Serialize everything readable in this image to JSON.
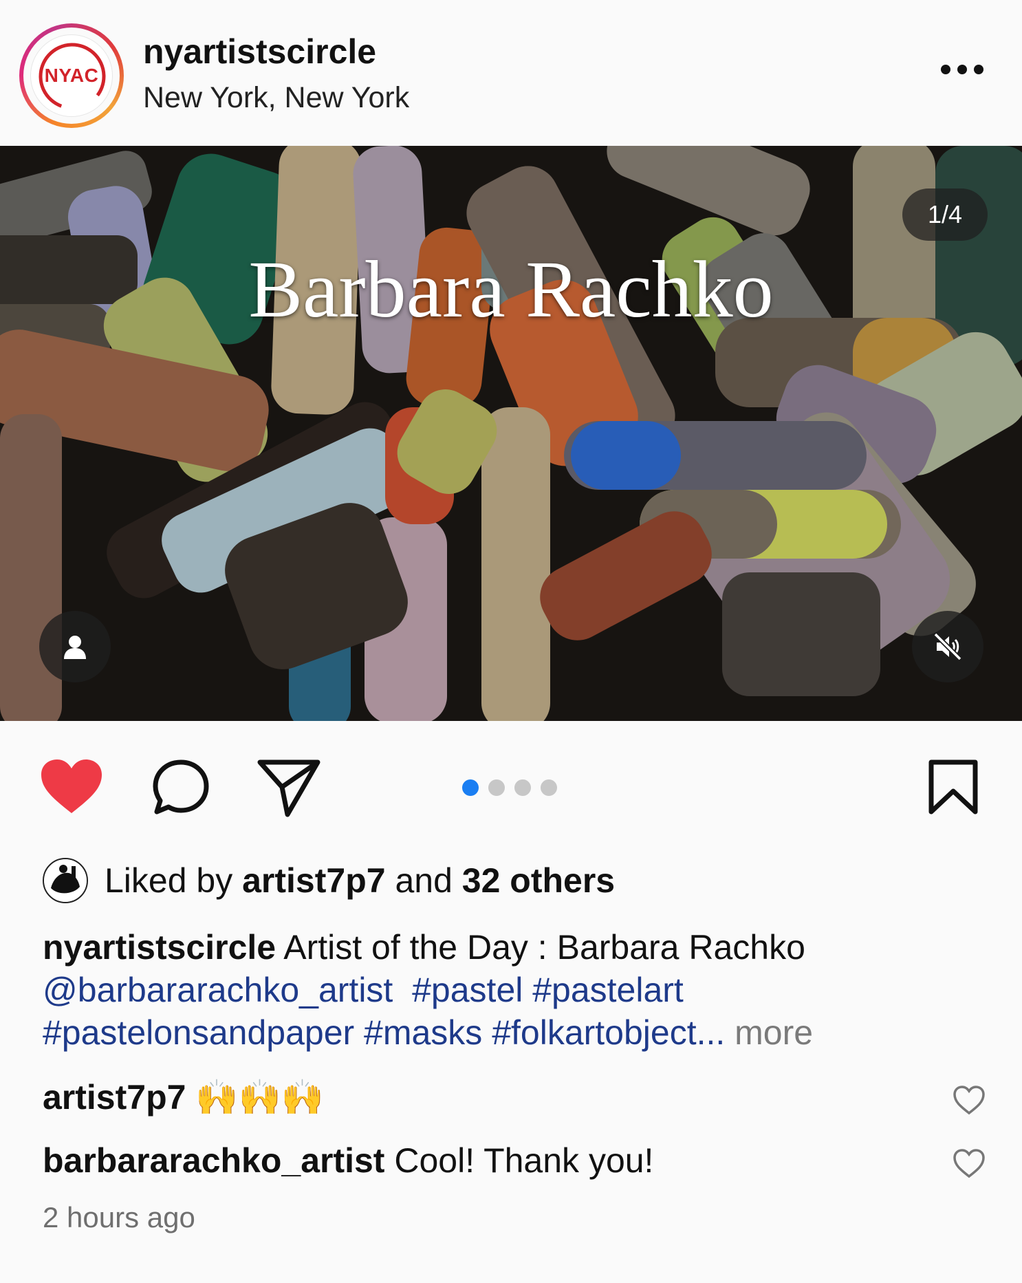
{
  "header": {
    "avatar_logo_text": "NYAC",
    "username": "nyartistscircle",
    "location": "New York, New York"
  },
  "media": {
    "overlay_title": "Barbara Rachko",
    "counter": "1/4",
    "slide_index": 1,
    "slide_total": 4
  },
  "colors": {
    "like_red": "#ee3a46",
    "pagination_active": "#1a7ef2",
    "link_blue": "#1e3a8a"
  },
  "likes": {
    "prefix": "Liked by ",
    "user": "artist7p7",
    "middle": " and ",
    "count": "32 others"
  },
  "caption": {
    "user": "nyartistscircle",
    "text": " Artist of the Day : Barbara Rachko",
    "mention": "@barbararachko_artist",
    "tags_line1": "#pastel #pastelart",
    "tags_line2": "#pastelonsandpaper #masks #folkartobject...",
    "more": " more"
  },
  "comments": [
    {
      "user": "artist7p7",
      "text": "🙌🙌🙌"
    },
    {
      "user": "barbararachko_artist",
      "text": "Cool!  Thank you!"
    }
  ],
  "time": "2 hours ago"
}
